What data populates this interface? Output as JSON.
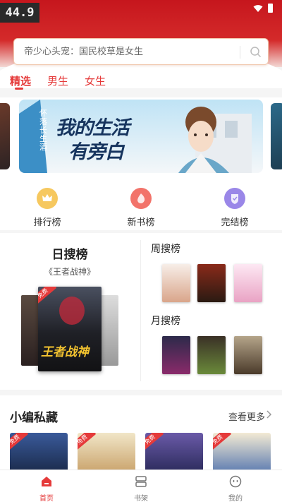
{
  "status": {
    "time": "44.9"
  },
  "search": {
    "placeholder": "帝少心头宠：国民校草是女生"
  },
  "tabs": [
    {
      "label": "精选",
      "active": true
    },
    {
      "label": "男生",
      "active": false
    },
    {
      "label": "女生",
      "active": false
    }
  ],
  "banner": {
    "headline_1": "我的生活",
    "headline_2": "有旁白",
    "side_text": "怀落长生酒"
  },
  "categories": [
    {
      "label": "排行榜",
      "icon": "crown-icon",
      "color": "#f6c85f"
    },
    {
      "label": "新书榜",
      "icon": "new-book-icon",
      "color": "#f2736a"
    },
    {
      "label": "完结榜",
      "icon": "complete-shield-icon",
      "color": "#9a87e8"
    }
  ],
  "ranking": {
    "daily_title": "日搜榜",
    "daily_book": "《王者战神》",
    "daily_cover_text": "王者战神",
    "weekly_title": "周搜榜",
    "monthly_title": "月搜榜"
  },
  "editor_picks": {
    "title": "小编私藏",
    "more_label": "查看更多",
    "free_tag": "免费"
  },
  "bottom_nav": [
    {
      "label": "首页",
      "active": true
    },
    {
      "label": "书架",
      "active": false
    },
    {
      "label": "我的",
      "active": false
    }
  ],
  "colors": {
    "brand": "#e53a3a",
    "header": "#c6161d"
  }
}
